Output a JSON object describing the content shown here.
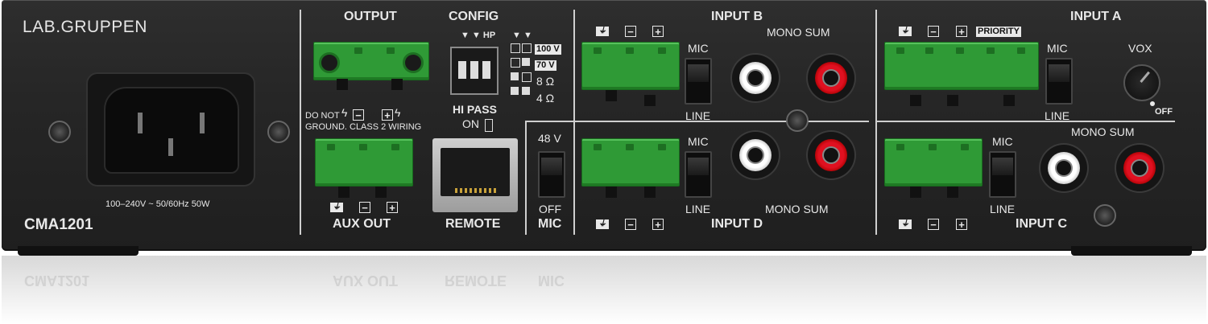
{
  "brand": {
    "logo_text": "LAB.GRUPPEN"
  },
  "model": {
    "name": "CMA1201"
  },
  "power": {
    "rating": "100–240V ~ 50/60Hz 50W"
  },
  "output": {
    "title": "OUTPUT",
    "warning_line1": "DO NOT",
    "warning_line2": "GROUND. CLASS 2 WIRING",
    "minus": "−",
    "plus": "+"
  },
  "aux_out": {
    "title": "AUX OUT",
    "ground": "⏚",
    "minus": "−",
    "plus": "+"
  },
  "config": {
    "title": "CONFIG",
    "hp_label": "▼ ▼ HP",
    "arrows": "▼ ▼",
    "options": [
      "100 V",
      "70 V",
      "8 Ω",
      "4 Ω"
    ],
    "hi_pass_label": "HI PASS",
    "hi_pass_on": "ON"
  },
  "remote": {
    "title": "REMOTE"
  },
  "mic_power": {
    "top": "48 V",
    "bottom": "OFF",
    "title": "MIC"
  },
  "input_b": {
    "title": "INPUT B",
    "mono_sum": "MONO SUM",
    "mic": "MIC",
    "line": "LINE",
    "ground": "⏚",
    "minus": "−",
    "plus": "+"
  },
  "input_d": {
    "title": "INPUT D",
    "mono_sum": "MONO SUM",
    "mic": "MIC",
    "line": "LINE",
    "ground": "⏚",
    "minus": "−",
    "plus": "+"
  },
  "input_a": {
    "title": "INPUT A",
    "priority": "PRIORITY",
    "mic": "MIC",
    "line": "LINE",
    "vox": "VOX",
    "vox_off": "OFF",
    "ground": "⏚",
    "minus": "−",
    "plus": "+"
  },
  "input_c": {
    "title": "INPUT C",
    "mono_sum": "MONO SUM",
    "mic": "MIC",
    "line": "LINE",
    "ground": "⏚",
    "minus": "−",
    "plus": "+"
  },
  "reflection": {
    "model": "CMA1201",
    "aux_out": "AUX OUT",
    "remote": "REMOTE",
    "mic": "MIC"
  }
}
